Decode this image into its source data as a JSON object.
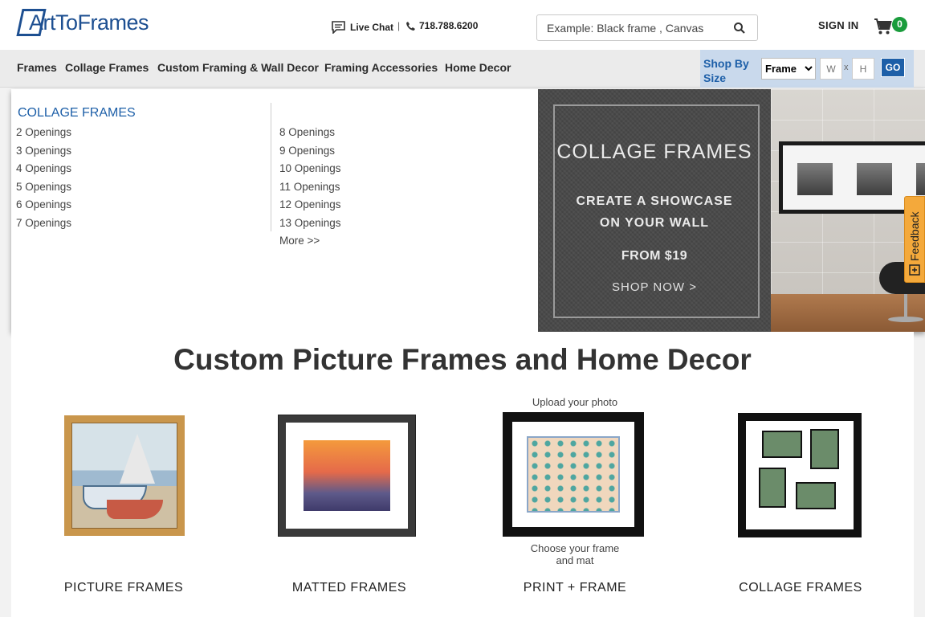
{
  "header": {
    "logo_text": "ArtToFrames",
    "live_chat": "Live Chat",
    "separator": "|",
    "phone": "718.788.6200",
    "search_placeholder": "Example: Black frame , Canvas",
    "sign_in": "SIGN IN",
    "cart_count": "0"
  },
  "nav": {
    "items": [
      "Frames",
      "Collage Frames",
      "Custom Framing & Wall Decor",
      "Framing Accessories",
      "Home Decor"
    ],
    "shop_by_size_label": "Shop By Size",
    "size_type_selected": "Frame",
    "width_placeholder": "W",
    "x_label": "x",
    "height_placeholder": "H",
    "go_label": "GO"
  },
  "dropdown": {
    "title": "COLLAGE FRAMES",
    "col1": [
      "2 Openings",
      "3 Openings",
      "4 Openings",
      "5 Openings",
      "6 Openings",
      "7 Openings"
    ],
    "col2": [
      "8 Openings",
      "9 Openings",
      "10 Openings",
      "11 Openings",
      "12 Openings",
      "13 Openings",
      "More >>"
    ],
    "promo": {
      "title": "COLLAGE FRAMES",
      "line1": "CREATE A SHOWCASE",
      "line2": "ON YOUR WALL",
      "price": "FROM $19",
      "cta": "SHOP NOW >"
    }
  },
  "feedback_label": "Feedback",
  "main": {
    "title": "Custom Picture Frames and Home Decor",
    "products": [
      {
        "caption": "PICTURE FRAMES"
      },
      {
        "caption": "MATTED FRAMES"
      },
      {
        "caption": "PRINT + FRAME",
        "upload_text": "Upload your photo",
        "choose_text_1": "Choose your frame",
        "choose_text_2": "and mat"
      },
      {
        "caption": "COLLAGE FRAMES"
      }
    ]
  },
  "colors": {
    "brand_blue": "#1d4f91",
    "link_blue": "#1d5fa8",
    "cart_green": "#1a9c3c",
    "feedback_orange": "#f4a93b",
    "size_box_bg": "#c9d9ec"
  }
}
